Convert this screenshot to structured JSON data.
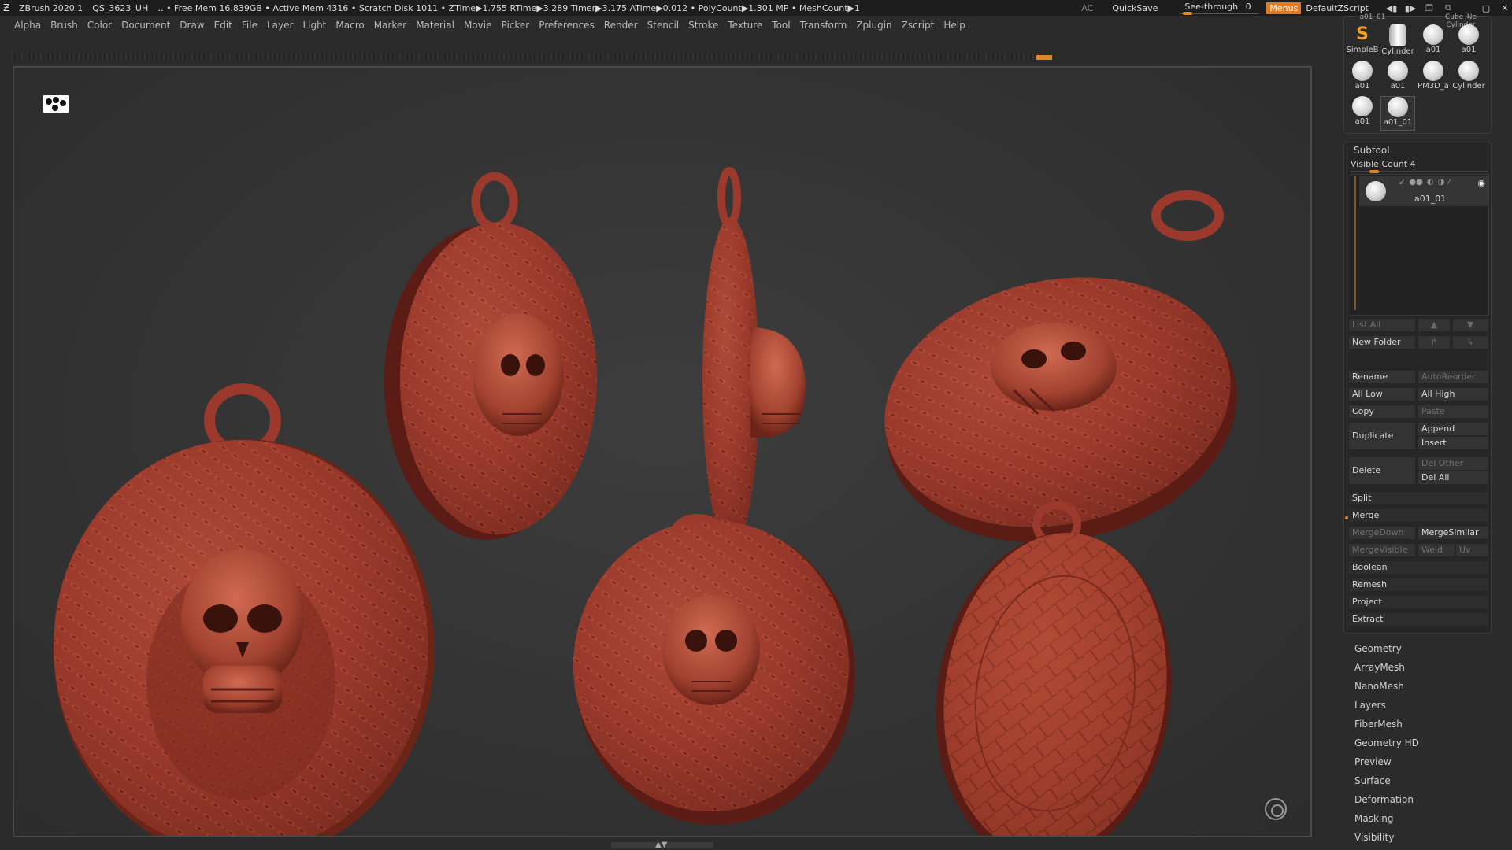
{
  "titlebar": {
    "app_name": "ZBrush 2020.1",
    "project": "QS_3623_UH",
    "stats": "‥ • Free Mem 16.839GB • Active Mem 4316 • Scratch Disk 1011 • ZTime▶1.755 RTime▶3.289 Timer▶3.175 ATime▶0.012 • PolyCount▶1.301 MP • MeshCount▶1",
    "ac": "AC",
    "quicksave": "QuickSave",
    "see_through_label": "See-through",
    "see_through_value": "0",
    "menus": "Menus",
    "default_zscript": "DefaultZScript"
  },
  "menubar": {
    "items": [
      "Alpha",
      "Brush",
      "Color",
      "Document",
      "Draw",
      "Edit",
      "File",
      "Layer",
      "Light",
      "Macro",
      "Marker",
      "Material",
      "Movie",
      "Picker",
      "Preferences",
      "Render",
      "Stencil",
      "Stroke",
      "Texture",
      "Tool",
      "Transform",
      "Zplugin",
      "Zscript",
      "Help"
    ]
  },
  "tool_thumbs": {
    "top_labels": [
      "a01_01",
      "Cube_Ne Cylinder"
    ],
    "items": [
      "SimpleB",
      "Cylinder",
      "a01",
      "a01",
      "a01",
      "a01",
      "PM3D_a",
      "Cylinder",
      "a01",
      "a01_01"
    ]
  },
  "subtool": {
    "title": "Subtool",
    "visible_count": "Visible Count 4",
    "item_name": "a01_01",
    "buttons": {
      "list_all": "List All",
      "new_folder": "New Folder",
      "rename": "Rename",
      "auto_reorder": "AutoReorder",
      "all_low": "All Low",
      "all_high": "All High",
      "copy": "Copy",
      "paste": "Paste",
      "duplicate": "Duplicate",
      "append": "Append",
      "insert": "Insert",
      "delete": "Delete",
      "del_other": "Del Other",
      "del_all": "Del All",
      "split": "Split",
      "merge": "Merge",
      "merge_down": "MergeDown",
      "merge_similar": "MergeSimilar",
      "merge_visible": "MergeVisible",
      "weld": "Weld",
      "uv": "Uv",
      "boolean": "Boolean",
      "remesh": "Remesh",
      "project": "Project",
      "extract": "Extract"
    }
  },
  "subpalettes": [
    "Geometry",
    "ArrayMesh",
    "NanoMesh",
    "Layers",
    "FiberMesh",
    "Geometry HD",
    "Preview",
    "Surface",
    "Deformation",
    "Masking",
    "Visibility"
  ],
  "colors": {
    "accent": "#e07b22",
    "clay": "#9b3a2c",
    "clay_dark": "#5a1c14"
  }
}
